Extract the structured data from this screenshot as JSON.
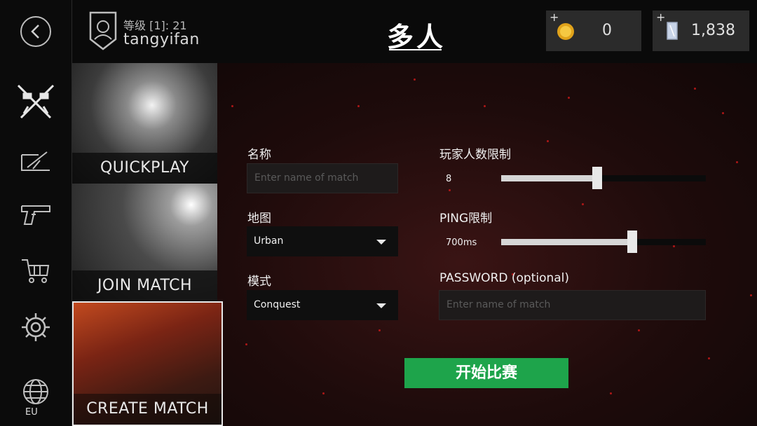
{
  "header": {
    "level_text": "等级 [1]: 21",
    "username": "tangyifan",
    "page_title": "多人",
    "coins": {
      "plus": "+",
      "value": "0"
    },
    "gems": {
      "plus": "+",
      "value": "1,838"
    }
  },
  "sidebar": {
    "items": [
      {
        "icon": "back-icon"
      },
      {
        "icon": "crossed-rifles-icon"
      },
      {
        "icon": "map-icon"
      },
      {
        "icon": "pistol-icon"
      },
      {
        "icon": "shopping-cart-icon"
      },
      {
        "icon": "gear-icon"
      },
      {
        "icon": "globe-icon"
      }
    ],
    "region": "EU"
  },
  "modes": [
    {
      "label": "QUICKPLAY"
    },
    {
      "label": "JOIN MATCH"
    },
    {
      "label": "CREATE MATCH"
    }
  ],
  "form": {
    "name_label": "名称",
    "name_placeholder": "Enter name of match",
    "map_label": "地图",
    "map_value": "Urban",
    "mode_label": "模式",
    "mode_value": "Conquest",
    "players_label": "玩家人数限制",
    "players_value": "8",
    "players_fraction": 0.47,
    "ping_label": "PING限制",
    "ping_value": "700ms",
    "ping_fraction": 0.64,
    "password_label": "PASSWORD (optional)",
    "password_placeholder": "Enter name of match",
    "start_button": "开始比赛"
  },
  "colors": {
    "start_button": "#1ea44b"
  }
}
